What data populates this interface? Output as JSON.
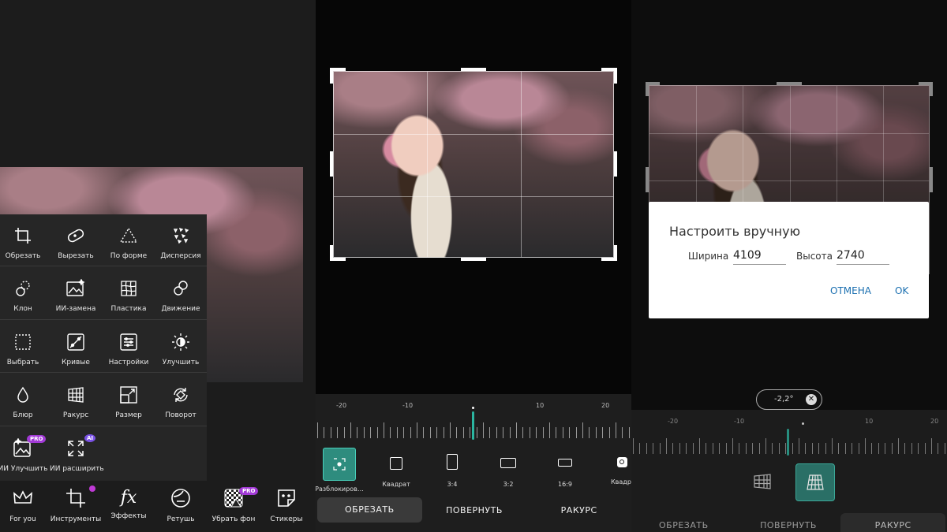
{
  "tools_panel": {
    "rows": [
      [
        {
          "label": "Обрезать",
          "icon": "crop-icon"
        },
        {
          "label": "Вырезать",
          "icon": "cutout-icon"
        },
        {
          "label": "По форме",
          "icon": "shape-icon"
        },
        {
          "label": "Дисперсия",
          "icon": "dispersion-icon"
        }
      ],
      [
        {
          "label": "Клон",
          "icon": "clone-icon"
        },
        {
          "label": "ИИ-замена",
          "icon": "ai-replace-icon"
        },
        {
          "label": "Пластика",
          "icon": "liquify-icon"
        },
        {
          "label": "Движение",
          "icon": "motion-icon"
        }
      ],
      [
        {
          "label": "Выбрать",
          "icon": "select-icon"
        },
        {
          "label": "Кривые",
          "icon": "curves-icon"
        },
        {
          "label": "Настройки",
          "icon": "adjust-icon"
        },
        {
          "label": "Улучшить",
          "icon": "enhance-icon"
        }
      ],
      [
        {
          "label": "Блюр",
          "icon": "blur-icon"
        },
        {
          "label": "Ракурс",
          "icon": "perspective-icon"
        },
        {
          "label": "Размер",
          "icon": "resize-icon"
        },
        {
          "label": "Поворот",
          "icon": "rotate-icon"
        }
      ],
      [
        {
          "label": "ИИ Улучшить",
          "icon": "ai-enhance-icon"
        },
        {
          "label": "ИИ расширить",
          "icon": "ai-expand-icon"
        }
      ]
    ],
    "pro_badge": "PRO",
    "ai_badge": "AI"
  },
  "bottom_nav": [
    {
      "label": "For you",
      "icon": "crown-icon"
    },
    {
      "label": "Инструменты",
      "icon": "crop-tool-icon"
    },
    {
      "label": "Эффекты",
      "icon": "fx-icon"
    },
    {
      "label": "Ретушь",
      "icon": "face-icon"
    },
    {
      "label": "Убрать фон",
      "icon": "remove-bg-icon"
    },
    {
      "label": "Стикеры",
      "icon": "sticker-icon"
    }
  ],
  "crop_screen": {
    "ruler_labels": [
      "-20",
      "-10",
      "10",
      "20"
    ],
    "ratios": [
      {
        "label": "Разблокиров…",
        "selected": true
      },
      {
        "label": "Квадрат"
      },
      {
        "label": "3:4"
      },
      {
        "label": "3:2"
      },
      {
        "label": "16:9"
      },
      {
        "label": "Квадра"
      }
    ],
    "tabs": [
      "ОБРЕЗАТЬ",
      "ПОВЕРНУТЬ",
      "РАКУРС"
    ],
    "active_tab": "ОБРЕЗАТЬ"
  },
  "perspective_screen": {
    "angle_value": "-2,2°",
    "ruler_labels": [
      "-20",
      "-10",
      "10",
      "20"
    ],
    "tabs": [
      "ОБРЕЗАТЬ",
      "ПОВЕРНУТЬ",
      "РАКУРС"
    ],
    "active_tab": "РАКУРС",
    "dialog": {
      "title": "Настроить вручную",
      "width_label": "Ширина",
      "width_value": "4109",
      "height_label": "Высота",
      "height_value": "2740",
      "cancel": "ОТМЕНА",
      "ok": "OK"
    }
  },
  "colors": {
    "accent": "#2bb5a0",
    "pro": "#a23ad6",
    "link": "#1a6fb0"
  }
}
